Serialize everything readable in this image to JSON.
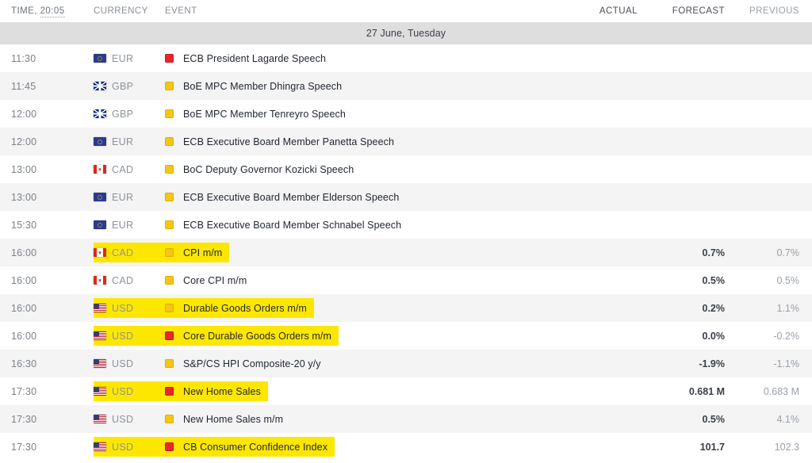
{
  "header": {
    "time_label": "TIME,",
    "time_value": "20:05",
    "currency_label": "CURRENCY",
    "event_label": "EVENT",
    "actual_label": "ACTUAL",
    "forecast_label": "FORECAST",
    "previous_label": "PREVIOUS"
  },
  "date_separator": "27 June, Tuesday",
  "colors": {
    "highlight": "#fde700",
    "impact_high": "#e8262a",
    "impact_medium": "#f5c518",
    "row_alt": "#f4f4f4",
    "date_bar": "#dededf"
  },
  "rows": [
    {
      "time": "11:30",
      "currency": "EUR",
      "flag": "eur-flag-icon",
      "impact": "high",
      "event": "ECB President Lagarde Speech",
      "actual": "",
      "forecast": "",
      "previous": "",
      "highlighted": false
    },
    {
      "time": "11:45",
      "currency": "GBP",
      "flag": "gbp-flag-icon",
      "impact": "medium",
      "event": "BoE MPC Member Dhingra Speech",
      "actual": "",
      "forecast": "",
      "previous": "",
      "highlighted": false
    },
    {
      "time": "12:00",
      "currency": "GBP",
      "flag": "gbp-flag-icon",
      "impact": "medium",
      "event": "BoE MPC Member Tenreyro Speech",
      "actual": "",
      "forecast": "",
      "previous": "",
      "highlighted": false
    },
    {
      "time": "12:00",
      "currency": "EUR",
      "flag": "eur-flag-icon",
      "impact": "medium",
      "event": "ECB Executive Board Member Panetta Speech",
      "actual": "",
      "forecast": "",
      "previous": "",
      "highlighted": false
    },
    {
      "time": "13:00",
      "currency": "CAD",
      "flag": "cad-flag-icon",
      "impact": "medium",
      "event": "BoC Deputy Governor Kozicki Speech",
      "actual": "",
      "forecast": "",
      "previous": "",
      "highlighted": false
    },
    {
      "time": "13:00",
      "currency": "EUR",
      "flag": "eur-flag-icon",
      "impact": "medium",
      "event": "ECB Executive Board Member Elderson Speech",
      "actual": "",
      "forecast": "",
      "previous": "",
      "highlighted": false
    },
    {
      "time": "15:30",
      "currency": "EUR",
      "flag": "eur-flag-icon",
      "impact": "medium",
      "event": "ECB Executive Board Member Schnabel Speech",
      "actual": "",
      "forecast": "",
      "previous": "",
      "highlighted": false
    },
    {
      "time": "16:00",
      "currency": "CAD",
      "flag": "cad-flag-icon",
      "impact": "medium",
      "event": "CPI m/m",
      "actual": "",
      "forecast": "0.7%",
      "previous": "0.7%",
      "highlighted": true
    },
    {
      "time": "16:00",
      "currency": "CAD",
      "flag": "cad-flag-icon",
      "impact": "medium",
      "event": "Core CPI m/m",
      "actual": "",
      "forecast": "0.5%",
      "previous": "0.5%",
      "highlighted": false
    },
    {
      "time": "16:00",
      "currency": "USD",
      "flag": "usd-flag-icon",
      "impact": "medium",
      "event": "Durable Goods Orders m/m",
      "actual": "",
      "forecast": "0.2%",
      "previous": "1.1%",
      "highlighted": true
    },
    {
      "time": "16:00",
      "currency": "USD",
      "flag": "usd-flag-icon",
      "impact": "high",
      "event": "Core Durable Goods Orders m/m",
      "actual": "",
      "forecast": "0.0%",
      "previous": "-0.2%",
      "highlighted": true
    },
    {
      "time": "16:30",
      "currency": "USD",
      "flag": "usd-flag-icon",
      "impact": "medium",
      "event": "S&P/CS HPI Composite-20 y/y",
      "actual": "",
      "forecast": "-1.9%",
      "previous": "-1.1%",
      "highlighted": false
    },
    {
      "time": "17:30",
      "currency": "USD",
      "flag": "usd-flag-icon",
      "impact": "high",
      "event": "New Home Sales",
      "actual": "",
      "forecast": "0.681 M",
      "previous": "0.683 M",
      "highlighted": true
    },
    {
      "time": "17:30",
      "currency": "USD",
      "flag": "usd-flag-icon",
      "impact": "medium",
      "event": "New Home Sales m/m",
      "actual": "",
      "forecast": "0.5%",
      "previous": "4.1%",
      "highlighted": false
    },
    {
      "time": "17:30",
      "currency": "USD",
      "flag": "usd-flag-icon",
      "impact": "high",
      "event": "CB Consumer Confidence Index",
      "actual": "",
      "forecast": "101.7",
      "previous": "102.3",
      "highlighted": true
    }
  ]
}
